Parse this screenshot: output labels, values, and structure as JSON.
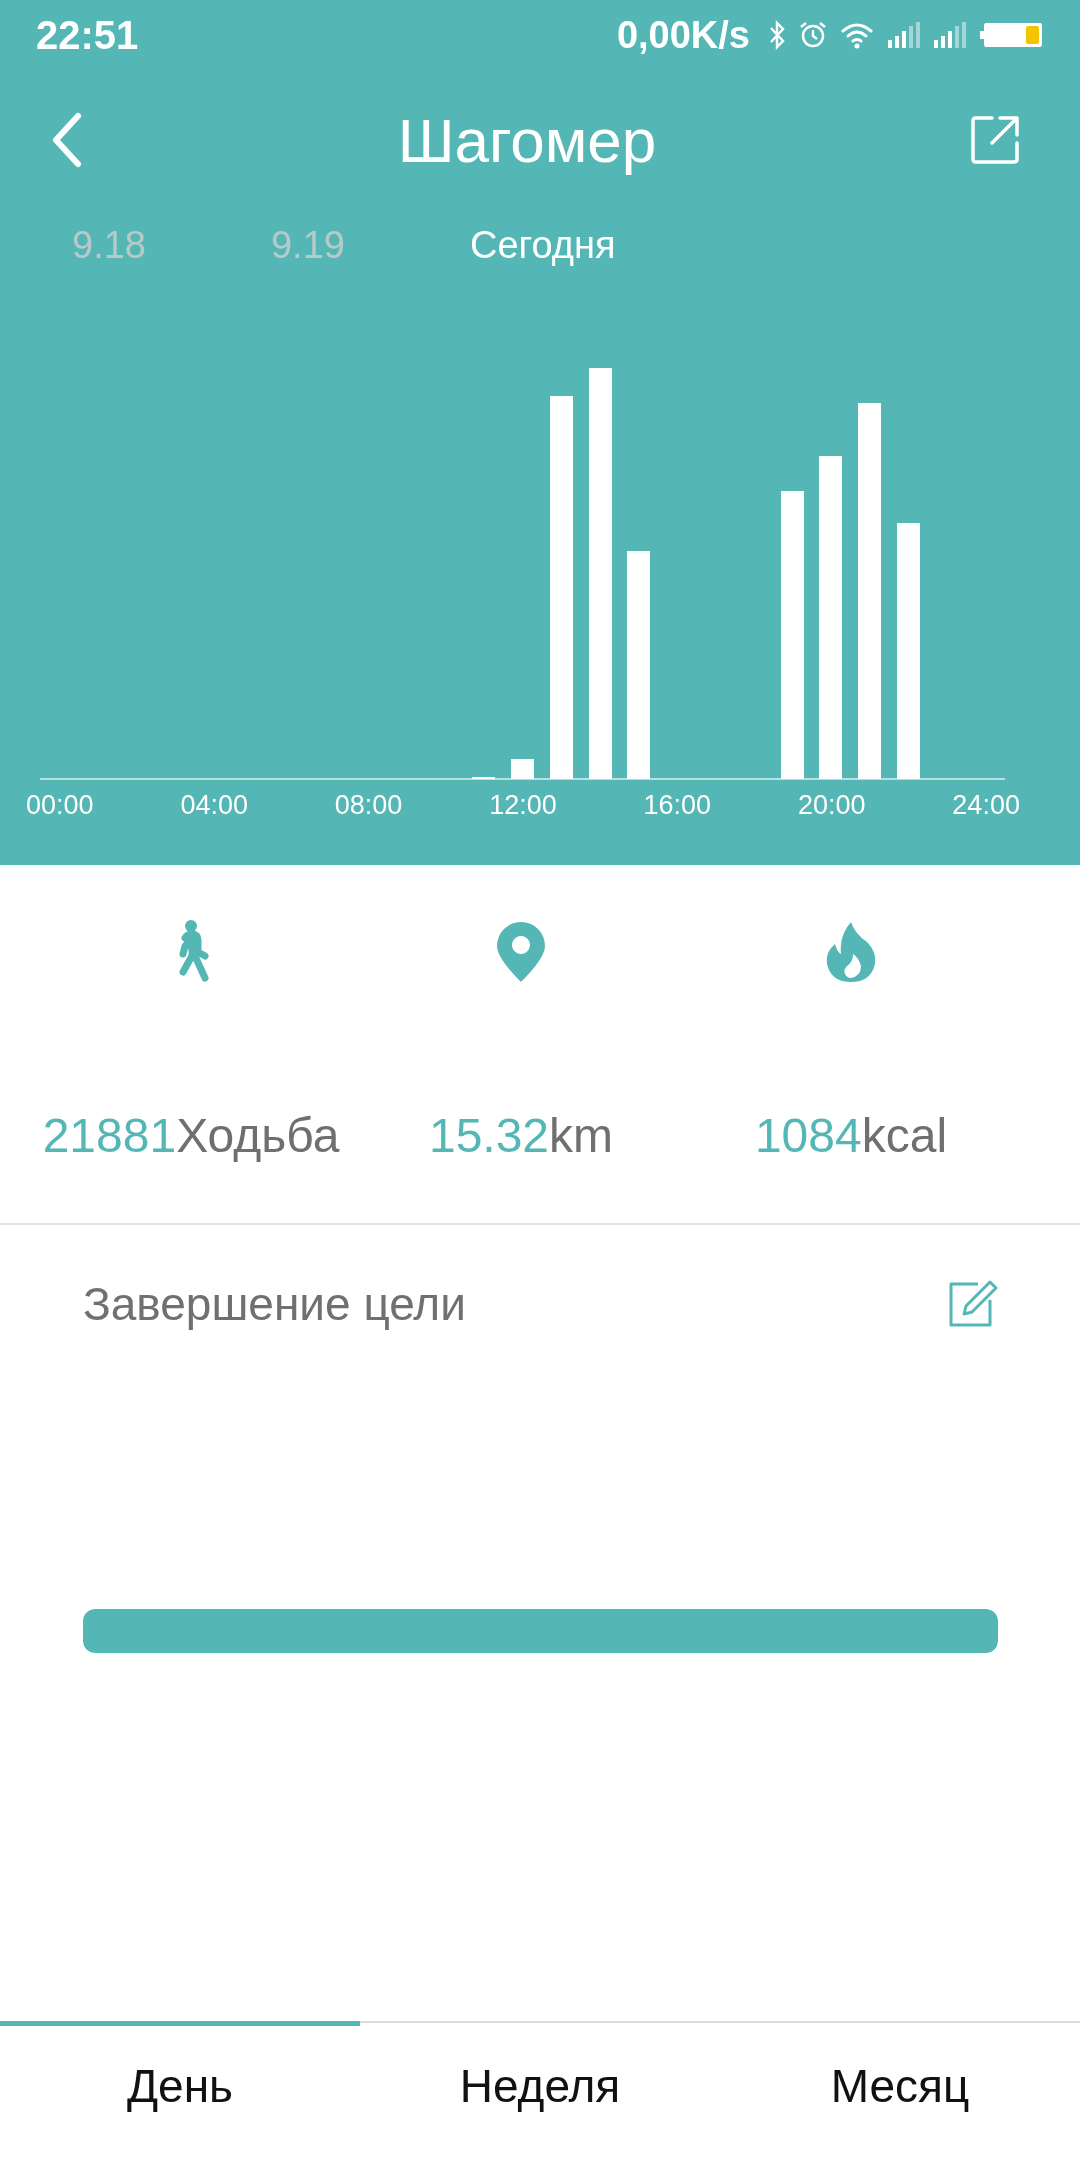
{
  "status_bar": {
    "time": "22:51",
    "net_speed": "0,00K/s"
  },
  "header": {
    "title": "Шагомер"
  },
  "dates": [
    {
      "label": "9.18",
      "selected": false
    },
    {
      "label": "9.19",
      "selected": false
    },
    {
      "label": "Сегодня",
      "selected": true
    }
  ],
  "chart": {
    "x_labels": [
      "00:00",
      "04:00",
      "08:00",
      "12:00",
      "16:00",
      "20:00",
      "24:00"
    ]
  },
  "stats": [
    {
      "kind": "steps",
      "value": "21881",
      "unit": "Ходьба"
    },
    {
      "kind": "distance",
      "value": "15.32",
      "unit": "km"
    },
    {
      "kind": "calories",
      "value": "1084",
      "unit": "kcal"
    }
  ],
  "goal": {
    "title": "Завершение цели",
    "level": 1
  },
  "tabs": [
    {
      "label": "День",
      "selected": true
    },
    {
      "label": "Неделя",
      "selected": false
    },
    {
      "label": "Месяц",
      "selected": false
    }
  ]
}
